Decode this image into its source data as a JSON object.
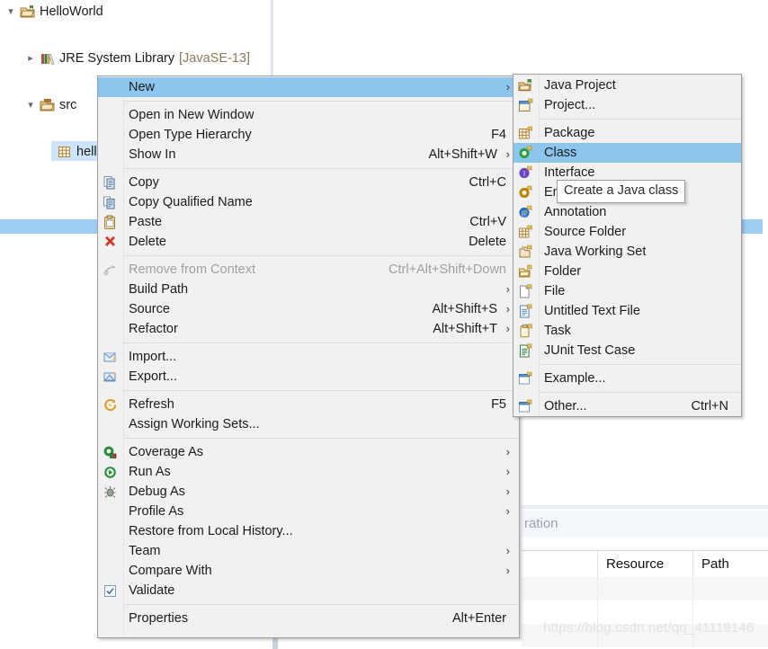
{
  "app": "Eclipse IDE Package Explorer with context menu",
  "tree": {
    "items": [
      {
        "label": "HelloWorld",
        "suffix": "",
        "icon": "java-project-icon",
        "twisty": "v",
        "indent": 22,
        "selected": false
      },
      {
        "label": "JRE System Library",
        "suffix": "[JavaSE-13]",
        "icon": "jre-library-icon",
        "twisty": ">",
        "indent": 44,
        "selected": false
      },
      {
        "label": "src",
        "suffix": "",
        "icon": "source-folder-icon",
        "twisty": "v",
        "indent": 44,
        "selected": false
      },
      {
        "label": "helloWorld",
        "suffix": "",
        "icon": "package-icon",
        "twisty": "",
        "indent": 66,
        "selected": true
      }
    ]
  },
  "context_menu": {
    "name": "project-context-menu",
    "items": [
      {
        "label": "New",
        "accel": "",
        "arrow": true,
        "icon": "",
        "highlight": true,
        "disabled": false
      },
      {
        "sep": true
      },
      {
        "label": "Open in New Window",
        "accel": "",
        "arrow": false,
        "icon": "",
        "highlight": false,
        "disabled": false
      },
      {
        "label": "Open Type Hierarchy",
        "accel": "F4",
        "arrow": false,
        "icon": "",
        "highlight": false,
        "disabled": false
      },
      {
        "label": "Show In",
        "accel": "Alt+Shift+W",
        "arrow": true,
        "icon": "",
        "highlight": false,
        "disabled": false
      },
      {
        "sep": true
      },
      {
        "label": "Copy",
        "accel": "Ctrl+C",
        "arrow": false,
        "icon": "copy-icon",
        "highlight": false,
        "disabled": false
      },
      {
        "label": "Copy Qualified Name",
        "accel": "",
        "arrow": false,
        "icon": "copy-qualified-icon",
        "highlight": false,
        "disabled": false
      },
      {
        "label": "Paste",
        "accel": "Ctrl+V",
        "arrow": false,
        "icon": "paste-icon",
        "highlight": false,
        "disabled": false
      },
      {
        "label": "Delete",
        "accel": "Delete",
        "arrow": false,
        "icon": "delete-icon",
        "highlight": false,
        "disabled": false
      },
      {
        "sep": true
      },
      {
        "label": "Remove from Context",
        "accel": "Ctrl+Alt+Shift+Down",
        "arrow": false,
        "icon": "remove-context-icon",
        "highlight": false,
        "disabled": true
      },
      {
        "label": "Build Path",
        "accel": "",
        "arrow": true,
        "icon": "",
        "highlight": false,
        "disabled": false
      },
      {
        "label": "Source",
        "accel": "Alt+Shift+S",
        "arrow": true,
        "icon": "",
        "highlight": false,
        "disabled": false
      },
      {
        "label": "Refactor",
        "accel": "Alt+Shift+T",
        "arrow": true,
        "icon": "",
        "highlight": false,
        "disabled": false
      },
      {
        "sep": true
      },
      {
        "label": "Import...",
        "accel": "",
        "arrow": false,
        "icon": "import-icon",
        "highlight": false,
        "disabled": false
      },
      {
        "label": "Export...",
        "accel": "",
        "arrow": false,
        "icon": "export-icon",
        "highlight": false,
        "disabled": false
      },
      {
        "sep": true
      },
      {
        "label": "Refresh",
        "accel": "F5",
        "arrow": false,
        "icon": "refresh-icon",
        "highlight": false,
        "disabled": false
      },
      {
        "label": "Assign Working Sets...",
        "accel": "",
        "arrow": false,
        "icon": "",
        "highlight": false,
        "disabled": false
      },
      {
        "sep": true
      },
      {
        "label": "Coverage As",
        "accel": "",
        "arrow": true,
        "icon": "coverage-icon",
        "highlight": false,
        "disabled": false
      },
      {
        "label": "Run As",
        "accel": "",
        "arrow": true,
        "icon": "run-icon",
        "highlight": false,
        "disabled": false
      },
      {
        "label": "Debug As",
        "accel": "",
        "arrow": true,
        "icon": "debug-icon",
        "highlight": false,
        "disabled": false
      },
      {
        "label": "Profile As",
        "accel": "",
        "arrow": true,
        "icon": "",
        "highlight": false,
        "disabled": false
      },
      {
        "label": "Restore from Local History...",
        "accel": "",
        "arrow": false,
        "icon": "",
        "highlight": false,
        "disabled": false
      },
      {
        "label": "Team",
        "accel": "",
        "arrow": true,
        "icon": "",
        "highlight": false,
        "disabled": false
      },
      {
        "label": "Compare With",
        "accel": "",
        "arrow": true,
        "icon": "",
        "highlight": false,
        "disabled": false
      },
      {
        "label": "Validate",
        "accel": "",
        "arrow": false,
        "icon": "checkbox-checked-icon",
        "highlight": false,
        "disabled": false
      },
      {
        "sep": true
      },
      {
        "label": "Properties",
        "accel": "Alt+Enter",
        "arrow": false,
        "icon": "",
        "highlight": false,
        "disabled": false
      }
    ]
  },
  "new_submenu": {
    "name": "new-submenu",
    "items": [
      {
        "label": "Java Project",
        "accel": "",
        "icon": "java-project-new-icon",
        "highlight": false
      },
      {
        "label": "Project...",
        "accel": "",
        "icon": "project-new-icon",
        "highlight": false
      },
      {
        "sep": true
      },
      {
        "label": "Package",
        "accel": "",
        "icon": "package-new-icon",
        "highlight": false
      },
      {
        "label": "Class",
        "accel": "",
        "icon": "class-new-icon",
        "highlight": true
      },
      {
        "label": "Interface",
        "accel": "",
        "icon": "interface-new-icon",
        "highlight": false
      },
      {
        "label": "Enum",
        "accel": "",
        "icon": "enum-new-icon",
        "highlight": false
      },
      {
        "label": "Annotation",
        "accel": "",
        "icon": "annotation-new-icon",
        "highlight": false
      },
      {
        "label": "Source Folder",
        "accel": "",
        "icon": "source-folder-new-icon",
        "highlight": false
      },
      {
        "label": "Java Working Set",
        "accel": "",
        "icon": "java-working-set-icon",
        "highlight": false
      },
      {
        "label": "Folder",
        "accel": "",
        "icon": "folder-new-icon",
        "highlight": false
      },
      {
        "label": "File",
        "accel": "",
        "icon": "file-new-icon",
        "highlight": false
      },
      {
        "label": "Untitled Text File",
        "accel": "",
        "icon": "text-file-new-icon",
        "highlight": false
      },
      {
        "label": "Task",
        "accel": "",
        "icon": "task-new-icon",
        "highlight": false
      },
      {
        "label": "JUnit Test Case",
        "accel": "",
        "icon": "junit-test-new-icon",
        "highlight": false
      },
      {
        "sep": true
      },
      {
        "label": "Example...",
        "accel": "",
        "icon": "example-new-icon",
        "highlight": false
      },
      {
        "sep": true
      },
      {
        "label": "Other...",
        "accel": "Ctrl+N",
        "icon": "other-new-icon",
        "highlight": false
      }
    ]
  },
  "tooltip": {
    "text": "Create a Java class"
  },
  "problems_view": {
    "title_partial": "ration",
    "columns": [
      "",
      "Resource",
      "Path"
    ]
  },
  "watermark": {
    "text": "https://blog.csdn.net/qq_41119146"
  },
  "colors": {
    "menu_bg": "#f1f1f1",
    "menu_border": "#9e9e9e",
    "highlight": "#8cc6ee",
    "tree_selection": "#cce5fb",
    "accent_blue": "#9ccdf5"
  }
}
